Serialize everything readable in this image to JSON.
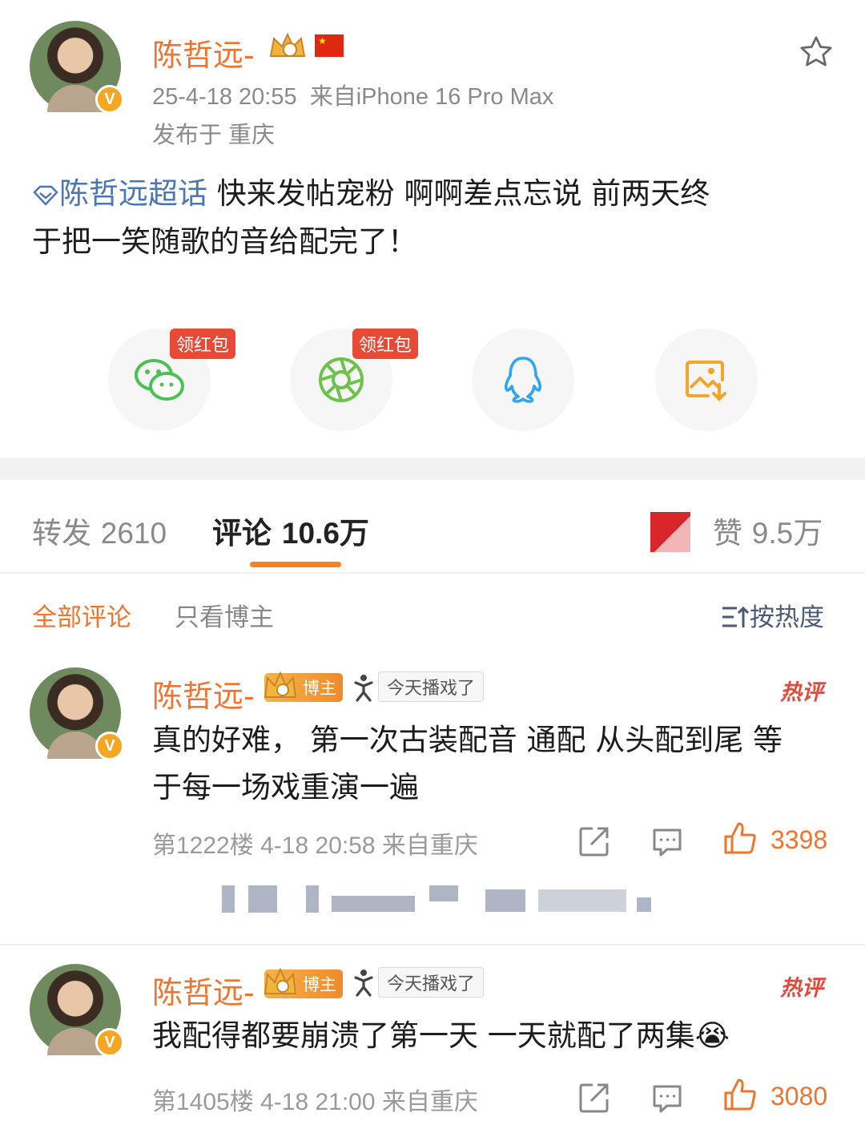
{
  "post": {
    "username": "陈哲远-",
    "time": "25-4-18 20:55",
    "source": "来自iPhone 16 Pro Max",
    "location": "发布于 重庆",
    "topic": "陈哲远超话",
    "text_line1": "快来发帖宠粉 啊啊差点忘说 前两天终",
    "text_line2": "于把一笑随歌的音给配完了！"
  },
  "share": {
    "red_packet_label": "领红包",
    "icons": [
      "wechat-icon",
      "moments-icon",
      "qq-icon",
      "save-image-icon"
    ]
  },
  "stats": {
    "repost_label": "转发",
    "repost_count": "2610",
    "comment_label": "评论",
    "comment_count": "10.6万",
    "like_label": "赞",
    "like_count": "9.5万"
  },
  "filters": {
    "all": "全部评论",
    "author_only": "只看博主",
    "sort": "按热度"
  },
  "comments": [
    {
      "username": "陈哲远-",
      "badge": "博主",
      "tag": "今天播戏了",
      "hot": "热评",
      "text_line1": "真的好难， 第一次古装配音 通配 从头配到尾 等",
      "text_line2": "于每一场戏重演一遍",
      "floor": "第1222楼",
      "time": "4-18 20:58",
      "location": "来自重庆",
      "likes": "3398"
    },
    {
      "username": "陈哲远-",
      "badge": "博主",
      "tag": "今天播戏了",
      "hot": "热评",
      "text_line1": "我配得都要崩溃了第一天 一天就配了两集",
      "emoji": "😭",
      "floor": "第1405楼",
      "time": "4-18 21:00",
      "location": "来自重庆",
      "likes": "3080"
    }
  ],
  "colors": {
    "accent": "#f0742b",
    "topic": "#4b76b6",
    "red_packet": "#e94a36"
  }
}
